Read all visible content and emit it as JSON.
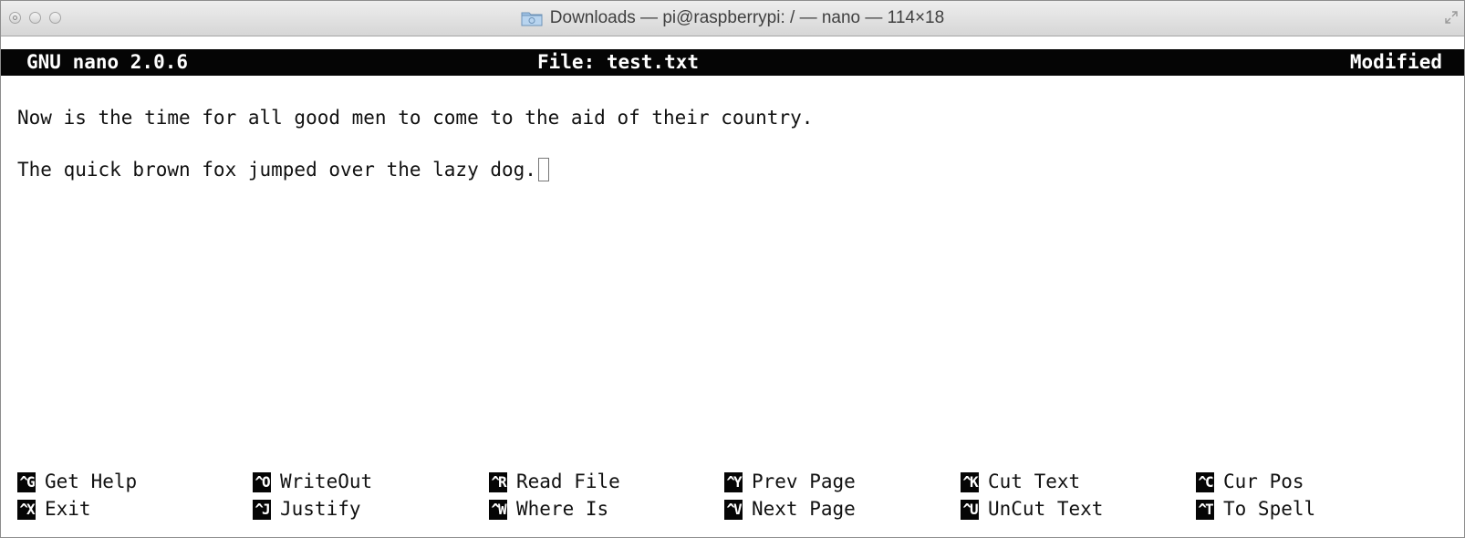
{
  "window": {
    "title": "Downloads — pi@raspberrypi: / — nano — 114×18"
  },
  "nano": {
    "version": "GNU nano 2.0.6",
    "file": "File: test.txt",
    "status": "Modified"
  },
  "content": {
    "lines": [
      "Now is the time for all good men to come to the aid of their country.",
      "The quick brown fox jumped over the lazy dog."
    ]
  },
  "shortcuts": [
    {
      "key": "^G",
      "label": "Get Help"
    },
    {
      "key": "^O",
      "label": "WriteOut"
    },
    {
      "key": "^R",
      "label": "Read File"
    },
    {
      "key": "^Y",
      "label": "Prev Page"
    },
    {
      "key": "^K",
      "label": "Cut Text"
    },
    {
      "key": "^C",
      "label": "Cur Pos"
    },
    {
      "key": "^X",
      "label": "Exit"
    },
    {
      "key": "^J",
      "label": "Justify"
    },
    {
      "key": "^W",
      "label": "Where Is"
    },
    {
      "key": "^V",
      "label": "Next Page"
    },
    {
      "key": "^U",
      "label": "UnCut Text"
    },
    {
      "key": "^T",
      "label": "To Spell"
    }
  ],
  "colors": {
    "terminal_bg": "#ffffff",
    "terminal_fg": "#111111",
    "inverse_bg": "#050505",
    "inverse_fg": "#ffffff"
  },
  "icons": [
    "close-icon",
    "minimize-icon",
    "zoom-icon",
    "folder-icon",
    "fullscreen-icon"
  ]
}
